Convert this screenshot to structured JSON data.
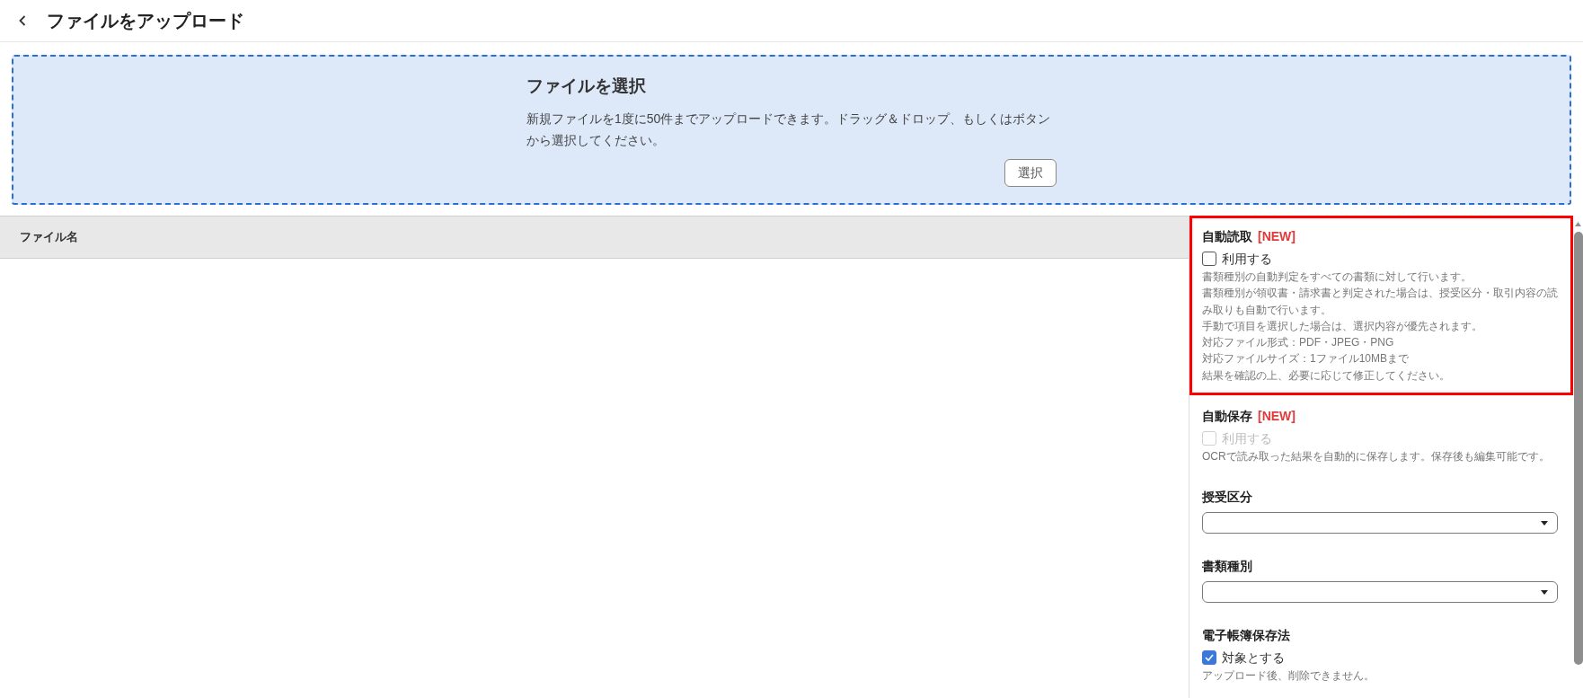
{
  "header": {
    "title": "ファイルをアップロード"
  },
  "drop_zone": {
    "title": "ファイルを選択",
    "description": "新規ファイルを1度に50件までアップロードできます。ドラッグ＆ドロップ、もしくはボタンから選択してください。",
    "button": "選択"
  },
  "table": {
    "columns": [
      "ファイル名"
    ]
  },
  "settings": {
    "sections": [
      {
        "kind": "checkbox",
        "label": "自動読取",
        "badge": "[NEW]",
        "highlighted": true,
        "option": {
          "label": "利用する",
          "checked": false,
          "disabled": false
        },
        "notes": [
          "書類種別の自動判定をすべての書類に対して行います。",
          "書類種別が領収書・請求書と判定された場合は、授受区分・取引内容の読み取りも自動で行います。",
          "手動で項目を選択した場合は、選択内容が優先されます。",
          "対応ファイル形式：PDF・JPEG・PNG",
          "対応ファイルサイズ：1ファイル10MBまで",
          "結果を確認の上、必要に応じて修正してください。"
        ]
      },
      {
        "kind": "checkbox",
        "label": "自動保存",
        "badge": "[NEW]",
        "highlighted": false,
        "option": {
          "label": "利用する",
          "checked": false,
          "disabled": true
        },
        "notes": [
          "OCRで読み取った結果を自動的に保存します。保存後も編集可能です。"
        ]
      },
      {
        "kind": "select",
        "label": "授受区分",
        "highlighted": false
      },
      {
        "kind": "select",
        "label": "書類種別",
        "highlighted": false
      },
      {
        "kind": "checkbox",
        "label": "電子帳簿保存法",
        "highlighted": false,
        "option": {
          "label": "対象とする",
          "checked": true,
          "disabled": false
        },
        "notes": [
          "アップロード後、削除できません。"
        ]
      }
    ]
  }
}
